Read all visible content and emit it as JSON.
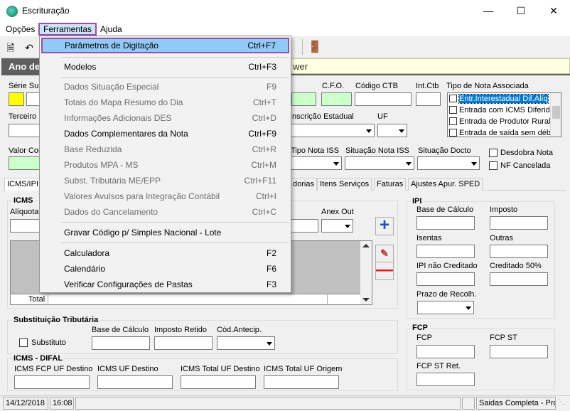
{
  "window": {
    "title": "Escrituração"
  },
  "menubar": {
    "items": [
      "Opções",
      "Ferramentas",
      "Ajuda"
    ]
  },
  "header": {
    "dark_label": "Ano de",
    "yellow_text": "wer"
  },
  "form": {
    "serie_label": "Série Sub",
    "cfo_label": "C.F.O.",
    "codigo_ctb_label": "Código CTB",
    "int_ctb_label": "Int.Ctb",
    "tipo_nota_label": "Tipo de Nota Associada",
    "terceiro_label": "Terceiro",
    "inscricao_label": "Inscrição Estadual",
    "uf_label": "UF",
    "valor_label": "Valor Cor",
    "tipo_nota_iss_label": "Tipo Nota ISS",
    "situacao_nota_iss_label": "Situação Nota ISS",
    "situacao_docto_label": "Situação Docto",
    "desdobra_nota_label": "Desdobra Nota",
    "nf_cancelada_label": "NF Cancelada",
    "tipo_nota_options": [
      "Entr.Interestadual Dif.Alíq",
      "Entrada com ICMS Diferido",
      "Entrada de Produtor Rural",
      "Entrada de saída sem débi"
    ]
  },
  "tabs": [
    "ICMS/IPI",
    "dorias",
    "Itens Serviços",
    "Faturas",
    "Ajustes Apur. SPED"
  ],
  "icms": {
    "title": "ICMS",
    "aliquota_label": "Alíquota",
    "anex_out_label": "Anex Out",
    "total_label": "Total"
  },
  "ipi": {
    "title": "IPI",
    "base_calculo": "Base de Cálculo",
    "imposto": "Imposto",
    "isentas": "Isentas",
    "outras": "Outras",
    "ipi_nao_creditado": "IPI não Creditado",
    "creditado_50": "Creditado 50%",
    "prazo_recolh": "Prazo de Recolh."
  },
  "fcp": {
    "title": "FCP",
    "fcp": "FCP",
    "fcp_st": "FCP ST",
    "fcp_st_ret": "FCP ST Ret."
  },
  "st": {
    "title": "Substituição Tributária",
    "substituto": "Substituto",
    "base_calculo": "Base de Cálculo",
    "imposto_retido": "Imposto Retido",
    "cod_antecip": "Cód.Antecip."
  },
  "difal": {
    "title": "ICMS - DIFAL",
    "fcp_uf_destino": "ICMS FCP UF Destino",
    "uf_destino": "ICMS UF Destino",
    "total_uf_destino": "ICMS Total UF Destino",
    "total_uf_origem": "ICMS Total UF Origem"
  },
  "status": {
    "date": "14/12/2018",
    "time": "16:08",
    "mode": "Saidas Completa - Pros"
  },
  "menu": {
    "items": [
      {
        "label": "Parâmetros de Digitação",
        "shortcut": "Ctrl+F7"
      },
      {
        "label": "Modelos",
        "shortcut": "Ctrl+F3"
      },
      {
        "label": "Dados Situação Especial",
        "shortcut": "F9"
      },
      {
        "label": "Totais do Mapa Resumo do Dia",
        "shortcut": "Ctrl+T"
      },
      {
        "label": "Informações Adicionais DES",
        "shortcut": "Ctrl+D"
      },
      {
        "label": "Dados Complementares da Nota",
        "shortcut": "Ctrl+F9"
      },
      {
        "label": "Base Reduzida",
        "shortcut": "Ctrl+R"
      },
      {
        "label": "Produtos MPA - MS",
        "shortcut": "Ctrl+M"
      },
      {
        "label": "Subst. Tributária ME/EPP",
        "shortcut": "Ctrl+F11"
      },
      {
        "label": "Valores Avulsos para Integração Contábil",
        "shortcut": "Ctrl+I"
      },
      {
        "label": "Dados do Cancelamento",
        "shortcut": "Ctrl+C"
      },
      {
        "label": "Gravar Código p/ Simples Nacional - Lote",
        "shortcut": ""
      },
      {
        "label": "Calculadora",
        "shortcut": "F2"
      },
      {
        "label": "Calendário",
        "shortcut": "F6"
      },
      {
        "label": "Verificar Configurações de Pastas",
        "shortcut": "F3"
      }
    ]
  }
}
